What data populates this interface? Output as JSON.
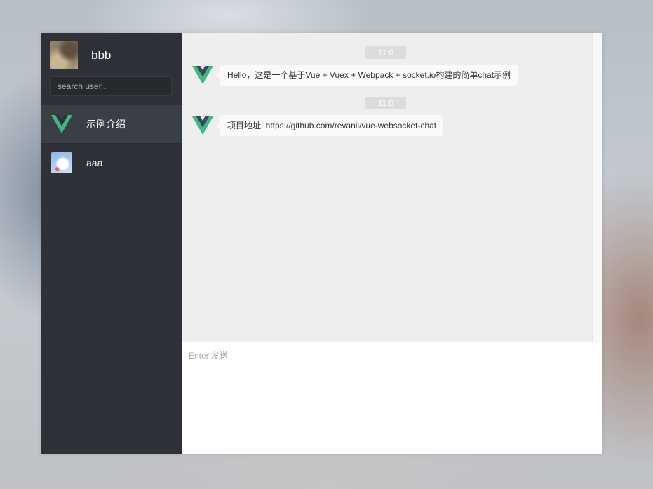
{
  "user": {
    "name": "bbb",
    "avatar_icon": "cat-photo"
  },
  "search": {
    "placeholder": "search user..."
  },
  "sessions": [
    {
      "name": "示例介绍",
      "avatar_icon": "vue-logo-icon",
      "active": true
    },
    {
      "name": "aaa",
      "avatar_icon": "anime-avatar",
      "active": false
    }
  ],
  "messages": [
    {
      "time": "11:0",
      "text": "Hello，这是一个基于Vue + Vuex + Webpack + socket.io构建的简单chat示例",
      "avatar_icon": "vue-logo-icon"
    },
    {
      "time": "11:0",
      "text": "项目地址: https://github.com/revanli/vue-websocket-chat",
      "avatar_icon": "vue-logo-icon"
    }
  ],
  "composer": {
    "placeholder": "Enter 发送"
  },
  "colors": {
    "vue_green": "#41b883",
    "vue_dark": "#35495e",
    "sidebar_bg": "#2e3238",
    "chat_bg": "#eeeeee"
  }
}
